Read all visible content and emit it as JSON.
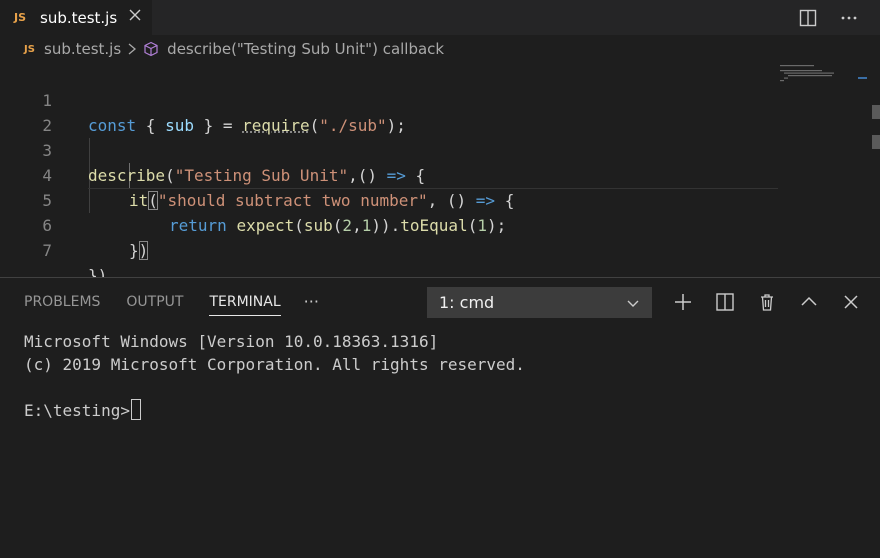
{
  "tab": {
    "icon": "JS",
    "label": "sub.test.js"
  },
  "breadcrumb": {
    "file_icon": "JS",
    "file": "sub.test.js",
    "symbol": "describe(\"Testing Sub Unit\") callback"
  },
  "editor": {
    "line_numbers": [
      "1",
      "2",
      "3",
      "4",
      "5",
      "6",
      "7"
    ],
    "code": {
      "l1_kw": "const",
      "l1_a": " { ",
      "l1_var": "sub",
      "l1_b": " } = ",
      "l1_fn": "require",
      "l1_c": "(",
      "l1_str": "\"./sub\"",
      "l1_d": ");",
      "l3_fn": "describe",
      "l3_a": "(",
      "l3_str": "\"Testing Sub Unit\"",
      "l3_b": ",() ",
      "l3_arrow": "=>",
      "l3_c": " {",
      "l4_fn": "it",
      "l4_paren": "(",
      "l4_str": "\"should subtract two number\"",
      "l4_a": ", () ",
      "l4_arrow": "=>",
      "l4_b": " {",
      "l5_kw": "return",
      "l5_sp": " ",
      "l5_fn1": "expect",
      "l5_a": "(",
      "l5_fn2": "sub",
      "l5_b": "(",
      "l5_n1": "2",
      "l5_c": ",",
      "l5_n2": "1",
      "l5_d": ")).",
      "l5_fn3": "toEqual",
      "l5_e": "(",
      "l5_n3": "1",
      "l5_f": ");",
      "l6_a": "}",
      "l6_paren": ")",
      "l7": "})"
    }
  },
  "panel": {
    "tabs": [
      "PROBLEMS",
      "OUTPUT",
      "TERMINAL"
    ],
    "more": "···",
    "terminal_select": "1: cmd"
  },
  "terminal": {
    "line1": "Microsoft Windows [Version 10.0.18363.1316]",
    "line2": "(c) 2019 Microsoft Corporation. All rights reserved.",
    "prompt": "E:\\testing>"
  },
  "colors": {
    "accent_js": "#e8a24a",
    "keyword": "#569cd6",
    "function": "#dcdcaa",
    "string": "#ce9178",
    "number": "#b5cea8"
  }
}
